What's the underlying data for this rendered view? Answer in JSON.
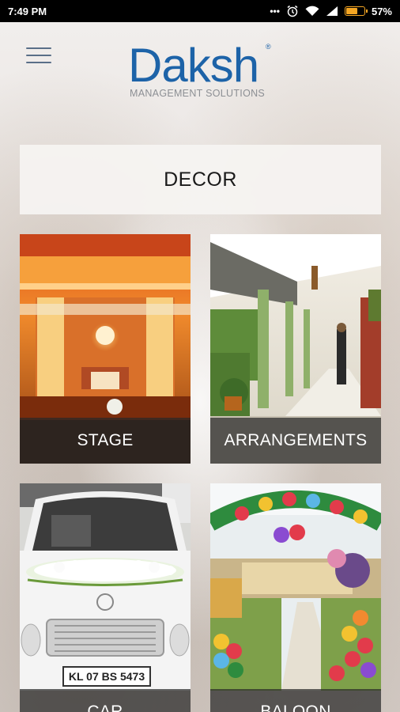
{
  "status_bar": {
    "time": "7:49 PM",
    "battery_percent": "57%",
    "battery_level": 0.57,
    "icons": [
      "more-dots-icon",
      "alarm-icon",
      "wifi-icon",
      "signal-icon",
      "battery-icon"
    ]
  },
  "header": {
    "menu_icon": "hamburger-menu-icon",
    "logo_text": "Daksh",
    "logo_registered": "®",
    "logo_subtitle": "MANAGEMENT SOLUTIONS"
  },
  "section": {
    "title": "DECOR"
  },
  "tiles": [
    {
      "label": "STAGE"
    },
    {
      "label": "ARRANGEMENTS"
    },
    {
      "label": "CAR",
      "plate_text": "KL 07 BS 5473"
    },
    {
      "label": "BALOON"
    }
  ],
  "colors": {
    "brand_blue": "#1d63a8",
    "caption_overlay": "#282828",
    "battery": "#f5a623"
  }
}
